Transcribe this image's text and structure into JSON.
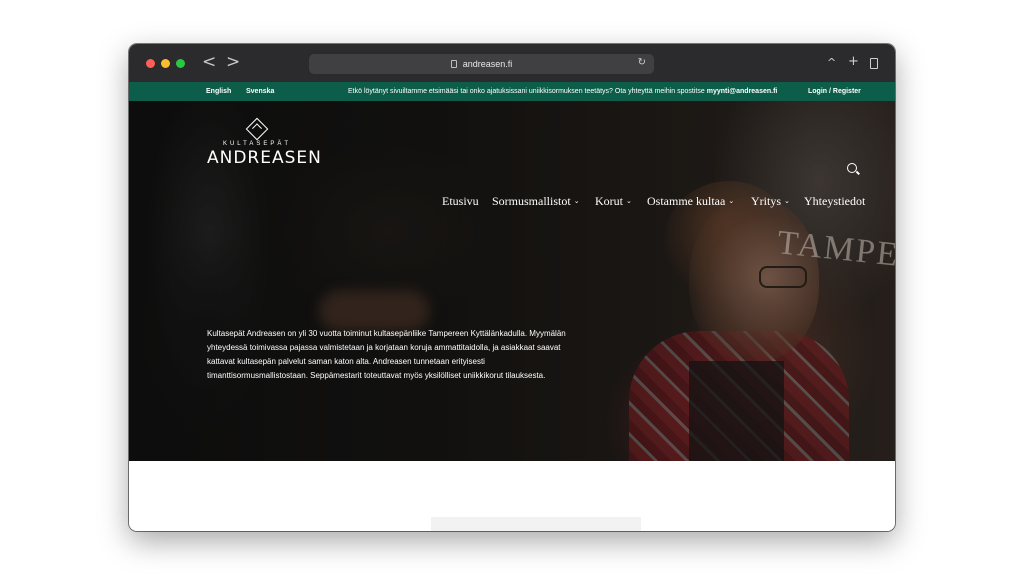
{
  "browser": {
    "url": "andreasen.fi",
    "back_glyph": "<",
    "forward_glyph": ">",
    "reload_glyph": "↻",
    "share_glyph": "^",
    "new_tab_glyph": "+",
    "icons": [
      "back-icon",
      "forward-icon",
      "page-icon",
      "reload-icon",
      "share-icon",
      "plus-icon",
      "tabs-icon"
    ]
  },
  "topbar": {
    "lang_en": "English",
    "lang_sv": "Svenska",
    "notice_text": "Etkö löytänyt sivuiltamme etsimääsi tai onko ajatuksissani uniikkisormuksen teetätys? Ota yhteyttä meihin spostitse",
    "notice_email": "myynti@andreasen.fi",
    "login": "Login / Register",
    "color": "#0d5d4b"
  },
  "logo": {
    "top": "KULTASEPÄT",
    "main": "ANDREASEN",
    "icon": "diamond-icon"
  },
  "nav": {
    "items": [
      {
        "label": "Etusivu",
        "chevron": ""
      },
      {
        "label": "Sormusmallistot",
        "chevron": "⌄"
      },
      {
        "label": "Korut",
        "chevron": "⌄"
      },
      {
        "label": "Ostamme kultaa",
        "chevron": "⌄"
      },
      {
        "label": "Yritys",
        "chevron": "⌄"
      },
      {
        "label": "Yhteystiedot",
        "chevron": ""
      }
    ],
    "search_icon": "search-icon"
  },
  "hero": {
    "watermark": "TAMPERE",
    "paragraph": "Kultasepät Andreasen on yli 30 vuotta toiminut kultasepänliike Tampereen Kyttälänkadulla. Myymälän yhteydessä toimivassa pajassa valmistetaan ja korjataan koruja ammattitaidolla, ja asiakkaat saavat kattavat kultasepän palvelut saman katon alta. Andreasen tunnetaan erityisesti timanttisormusmallistostaan. Seppämestarit toteuttavat myös yksilölliset uniikkikorut tilauksesta."
  }
}
